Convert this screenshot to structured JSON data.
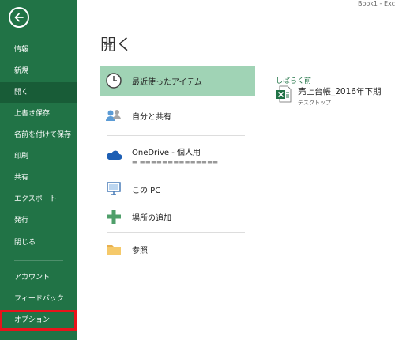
{
  "titlebar": {
    "text": "Book1 - Exc"
  },
  "sidebar": {
    "items": [
      {
        "label": "情報"
      },
      {
        "label": "新規"
      },
      {
        "label": "開く"
      },
      {
        "label": "上書き保存"
      },
      {
        "label": "名前を付けて保存"
      },
      {
        "label": "印刷"
      },
      {
        "label": "共有"
      },
      {
        "label": "エクスポート"
      },
      {
        "label": "発行"
      },
      {
        "label": "閉じる"
      },
      {
        "label": "アカウント"
      },
      {
        "label": "フィードバック"
      },
      {
        "label": "オプション"
      }
    ]
  },
  "main": {
    "title": "開く",
    "places": [
      {
        "label": "最近使ったアイテム",
        "icon": "clock-icon"
      },
      {
        "label": "自分と共有",
        "icon": "people-icon"
      },
      {
        "label": "OneDrive - 個人用",
        "sub": "▬ ▬▬▬▬▬▬▬▬▬▬▬▬▬▬",
        "icon": "cloud-icon"
      },
      {
        "label": "この PC",
        "icon": "computer-icon"
      },
      {
        "label": "場所の追加",
        "icon": "plus-icon"
      },
      {
        "label": "参照",
        "icon": "folder-icon"
      }
    ]
  },
  "recent": {
    "header": "しばらく前",
    "files": [
      {
        "name": "売上台帳_2016年下期",
        "path": "デスクトップ"
      }
    ]
  },
  "colors": {
    "accent": "#217346",
    "active_nav": "#185c37",
    "active_place": "#a0d3b5",
    "highlight": "#e8141b"
  }
}
